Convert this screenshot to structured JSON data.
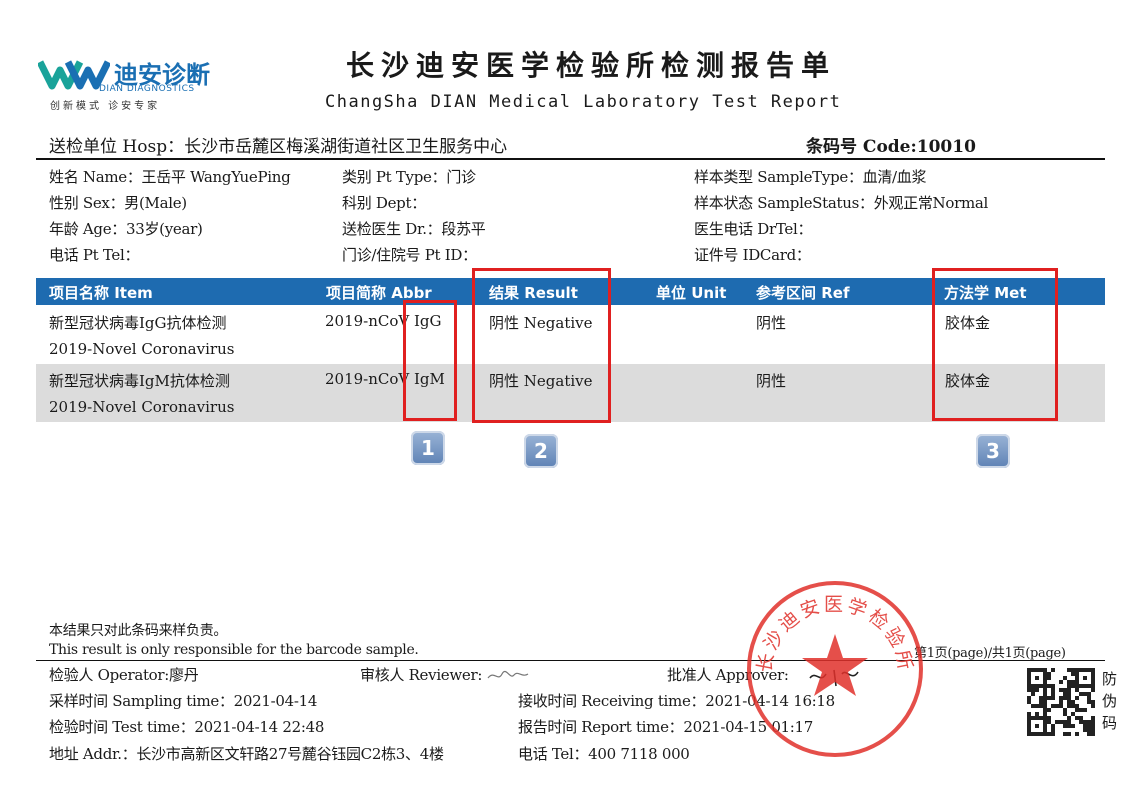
{
  "header": {
    "logo_name": "迪安诊断",
    "logo_sub": "DIAN DIAGNOSTICS",
    "logo_slogan": "创新模式  诊安专家",
    "title_cn": "长沙迪安医学检验所检测报告单",
    "title_en": "ChangSha DIAN Medical Laboratory Test Report",
    "hosp": "送检单位 Hosp：长沙市岳麓区梅溪湖街道社区卫生服务中心",
    "code": "条码号 Code:10010"
  },
  "patient": {
    "name": "姓名 Name：王岳平 WangYuePing",
    "sex": "性别 Sex：男(Male)",
    "age": "年龄 Age：33岁(year)",
    "tel": "电话 Pt Tel：",
    "pt_type": "类别 Pt Type：门诊",
    "dept": "科别 Dept：",
    "doctor": "送检医生 Dr.：段苏平",
    "pt_id": "门诊/住院号 Pt ID：",
    "sample_type": "样本类型 SampleType：血清/血浆",
    "sample_status": "样本状态 SampleStatus：外观正常Normal",
    "dr_tel": "医生电话 DrTel：",
    "idcard": "证件号 IDCard："
  },
  "table": {
    "headers": {
      "item": "项目名称 Item",
      "abbr": "项目简称 Abbr",
      "result": "结果 Result",
      "unit": "单位 Unit",
      "ref": "参考区间 Ref",
      "method": "方法学 Met"
    },
    "rows": [
      {
        "item_cn": "新型冠状病毒IgG抗体检测",
        "item_en": "2019-Novel Coronavirus",
        "abbr": "2019-nCoV IgG",
        "result": "阴性 Negative",
        "ref": "阴性",
        "method": "胶体金"
      },
      {
        "item_cn": "新型冠状病毒IgM抗体检测",
        "item_en": "2019-Novel Coronavirus",
        "abbr": "2019-nCoV IgM",
        "result": "阴性 Negative",
        "ref": "阴性",
        "method": "胶体金"
      }
    ]
  },
  "badges": [
    "1",
    "2",
    "3"
  ],
  "footer": {
    "note_cn": "本结果只对此条码来样负责。",
    "note_en": "This result is only responsible for the barcode sample.",
    "page": "第1页(page)/共1页(page)",
    "operator": "检验人 Operator:廖丹",
    "reviewer": "审核人 Reviewer:",
    "approver": "批准人 Approver:",
    "sampling_time": "采样时间 Sampling time：2021-04-14",
    "receiving_time": "接收时间 Receiving time：2021-04-14 16:18",
    "test_time": "检验时间 Test time：2021-04-14 22:48",
    "report_time": "报告时间 Report time：2021-04-15 01:17",
    "addr": "地址 Addr.：长沙市高新区文轩路27号麓谷钰园C2栋3、4楼",
    "tel": "电话 Tel：400 7118 000",
    "anti_fake": [
      "防",
      "伪",
      "码"
    ],
    "stamp_text": "长沙迪安医学检验所"
  },
  "colors": {
    "table_header": "#1e6bb0",
    "row_shade": "#dcdcdc",
    "highlight": "#e02020",
    "stamp": "#e0302a",
    "logo": "#1a6fb3"
  }
}
